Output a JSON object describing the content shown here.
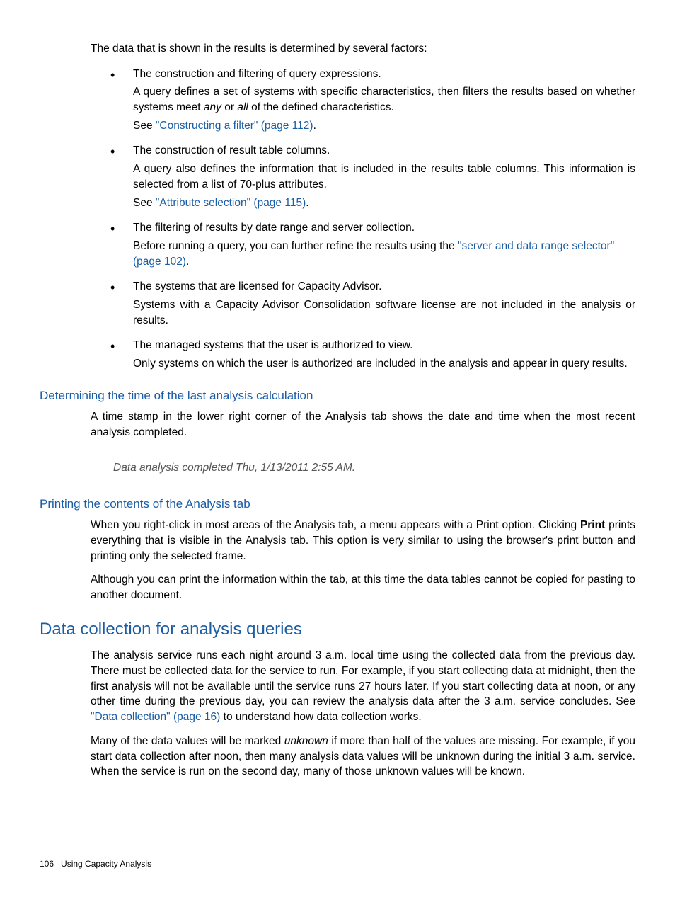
{
  "intro": "The data that is shown in the results is determined by several factors:",
  "bullets": {
    "b1": {
      "lead": "The construction and filtering of query expressions.",
      "p1a": "A query defines a set of systems with specific characteristics, then filters the results based on whether systems meet ",
      "any": "any",
      "or": " or ",
      "all": "all",
      "p1b": " of the defined characteristics.",
      "see": "See ",
      "link": "\"Constructing a filter\" (page 112)",
      "dot": "."
    },
    "b2": {
      "lead": "The construction of result table columns.",
      "p1": "A query also defines the information that is included in the results table columns. This information is selected from a list of 70-plus attributes.",
      "see": "See ",
      "link": "\"Attribute selection\" (page 115)",
      "dot": "."
    },
    "b3": {
      "lead": "The filtering of results by date range and server collection.",
      "p1a": "Before running a query, you can further refine the results using the ",
      "link": "\"server and data range selector\" (page 102)",
      "dot": "."
    },
    "b4": {
      "lead": "The systems that are licensed for Capacity Advisor.",
      "p1": "Systems with a Capacity Advisor Consolidation software license are not included in the analysis or results."
    },
    "b5": {
      "lead": "The managed systems that the user is authorized to view.",
      "p1": "Only systems on which the user is authorized are included in the analysis and appear in query results."
    }
  },
  "sub1": {
    "title": "Determining the time of the last analysis calculation",
    "p1": "A time stamp in the lower right corner of the Analysis tab shows the date and time when the most recent analysis completed.",
    "stamp": "Data analysis completed Thu, 1/13/2011 2:55 AM."
  },
  "sub2": {
    "title": "Printing the contents of the Analysis tab",
    "p1a": "When you right-click in most areas of the Analysis tab, a menu appears with a Print option. Clicking ",
    "print": "Print",
    "p1b": " prints everything that is visible in the Analysis tab. This option is very similar to using the browser's print button and printing only the selected frame.",
    "p2": "Although you can print the information within the tab, at this time the data tables cannot be copied for pasting to another document."
  },
  "section": {
    "title": "Data collection for analysis queries",
    "p1a": "The analysis service runs each night around 3 a.m. local time using the collected data from the previous day. There must be collected data for the service to run. For example, if you start collecting data at midnight, then the first analysis will not be available until the service runs 27 hours later. If you start collecting data at noon, or any other time during the previous day, you can review the analysis data after the 3 a.m. service concludes. See ",
    "link": "\"Data collection\" (page 16)",
    "p1b": " to understand how data collection works.",
    "p2a": "Many of the data values will be marked ",
    "unknown": "unknown",
    "p2b": " if more than half of the values are missing. For example, if you start data collection after noon, then many analysis data values will be unknown during the initial 3 a.m. service. When the service is run on the second day, many of those unknown values will be known."
  },
  "footer": {
    "page": "106",
    "label": "Using Capacity Analysis"
  }
}
